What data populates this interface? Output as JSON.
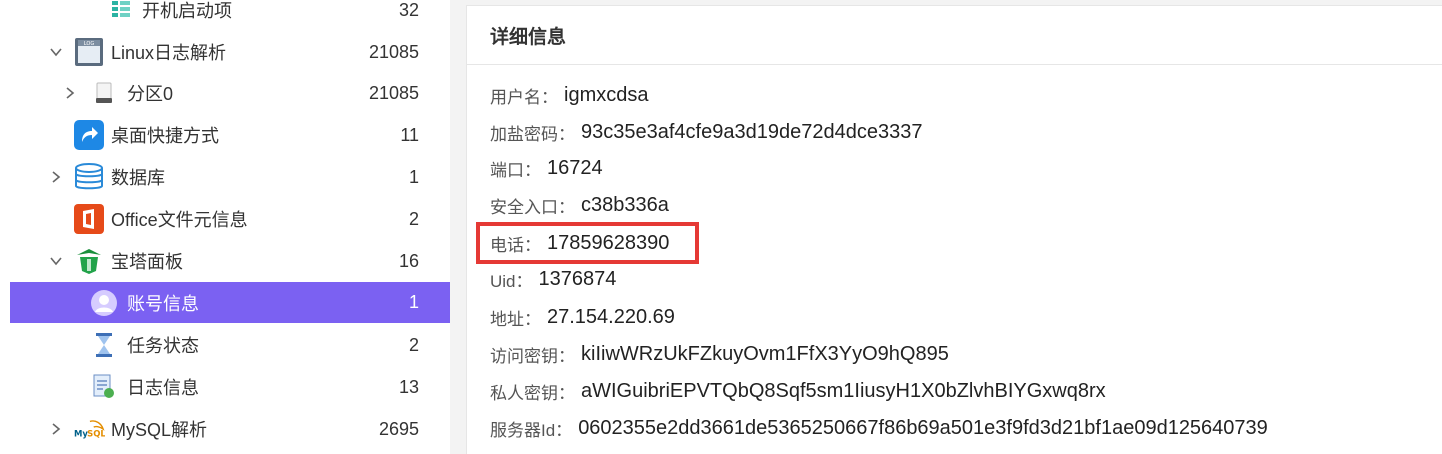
{
  "tree": {
    "items": [
      {
        "label": "开机启动项",
        "count": "32",
        "icon": "startup-list-icon",
        "chevron": "none"
      },
      {
        "label": "Linux日志解析",
        "count": "21085",
        "icon": "log-file-icon",
        "chevron": "expanded"
      },
      {
        "label": "分区0",
        "count": "21085",
        "icon": "drive-icon",
        "chevron": "collapsed"
      },
      {
        "label": "桌面快捷方式",
        "count": "11",
        "icon": "shortcut-arrow-icon",
        "chevron": "none"
      },
      {
        "label": "数据库",
        "count": "1",
        "icon": "database-icon",
        "chevron": "collapsed"
      },
      {
        "label": "Office文件元信息",
        "count": "2",
        "icon": "office-icon",
        "chevron": "none"
      },
      {
        "label": "宝塔面板",
        "count": "16",
        "icon": "bt-panel-icon",
        "chevron": "expanded"
      },
      {
        "label": "账号信息",
        "count": "1",
        "icon": "user-account-icon",
        "chevron": "none",
        "selected": true
      },
      {
        "label": "任务状态",
        "count": "2",
        "icon": "hourglass-icon",
        "chevron": "none"
      },
      {
        "label": "日志信息",
        "count": "13",
        "icon": "log-doc-icon",
        "chevron": "none"
      },
      {
        "label": "MySQL解析",
        "count": "2695",
        "icon": "mysql-icon",
        "chevron": "collapsed"
      }
    ]
  },
  "detail": {
    "title": "详细信息",
    "fields": [
      {
        "key": "用户名：",
        "value": "igmxcdsa"
      },
      {
        "key": "加盐密码：",
        "value": "93c35e3af4cfe9a3d19de72d4dce3337"
      },
      {
        "key": "端口：",
        "value": "16724"
      },
      {
        "key": "安全入口：",
        "value": "c38b336a"
      },
      {
        "key": "电话：",
        "value": "17859628390",
        "highlighted": true
      },
      {
        "key": "Uid：",
        "value": "1376874"
      },
      {
        "key": "地址：",
        "value": "27.154.220.69"
      },
      {
        "key": "访问密钥：",
        "value": "kiIiwWRzUkFZkuyOvm1FfX3YyO9hQ895"
      },
      {
        "key": "私人密钥：",
        "value": "aWIGuibriEPVTQbQ8Sqf5sm1IiusyH1X0bZlvhBIYGxwq8rx"
      },
      {
        "key": "服务器Id：",
        "value": "0602355e2dd3661de5365250667f86b69a501e3f9fd3d21bf1ae09d125640739"
      }
    ]
  },
  "colors": {
    "selected_bg": "#7b61f2",
    "highlight_border": "#e53935"
  }
}
